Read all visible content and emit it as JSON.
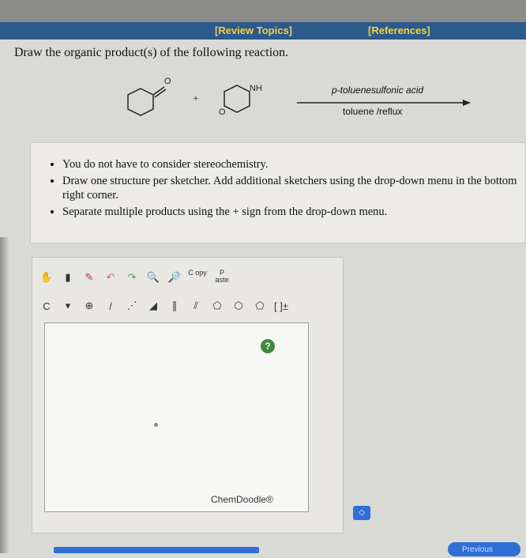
{
  "nav": {
    "review_topics": "[Review Topics]",
    "references": "[References]"
  },
  "question": {
    "text": "Draw the organic product(s) of the following reaction."
  },
  "reaction": {
    "ketone_oxygen_label": "O",
    "plus_sign": "+",
    "amine_n_label": "NH",
    "amine_o_label": "O",
    "reagent_top": "p-toluenesulfonic acid",
    "reagent_bottom": "toluene /reflux"
  },
  "instructions": [
    "You do not have to consider stereochemistry.",
    "Draw one structure per sketcher. Add additional sketchers using the drop-down menu in the bottom right corner.",
    "Separate multiple products using the + sign from the drop-down menu."
  ],
  "sketcher": {
    "copy_label": "C opy",
    "paste_label": "P aste",
    "atom_label": "C",
    "charge_label": "⊕",
    "bracket_label": "[ ]±",
    "help_label": "?",
    "brand_label": "ChemDoodle®",
    "icons": [
      "hand-icon",
      "eraser-icon",
      "lasso-icon",
      "undo-icon",
      "redo-icon",
      "zoom-in-icon",
      "zoom-out-icon"
    ]
  },
  "controls": {
    "stepper_label": "◇",
    "previous_label": "Previous"
  }
}
